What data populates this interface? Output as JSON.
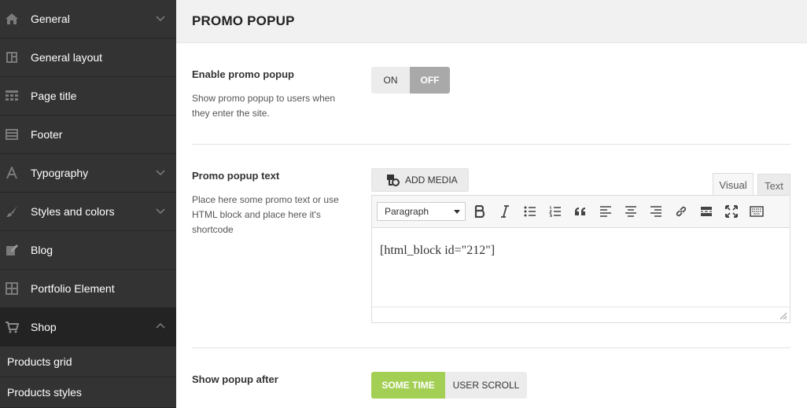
{
  "sidebar": {
    "items": [
      {
        "label": "General",
        "icon": "home-icon",
        "chevron": "down"
      },
      {
        "label": "General layout",
        "icon": "layout-icon",
        "chevron": ""
      },
      {
        "label": "Page title",
        "icon": "grid-icon",
        "chevron": ""
      },
      {
        "label": "Footer",
        "icon": "footer-icon",
        "chevron": ""
      },
      {
        "label": "Typography",
        "icon": "font-icon",
        "chevron": "down"
      },
      {
        "label": "Styles and colors",
        "icon": "brush-icon",
        "chevron": "down"
      },
      {
        "label": "Blog",
        "icon": "edit-icon",
        "chevron": ""
      },
      {
        "label": "Portfolio Element",
        "icon": "portfolio-icon",
        "chevron": ""
      },
      {
        "label": "Shop",
        "icon": "cart-icon",
        "chevron": "up",
        "active": true
      }
    ],
    "sub_items": [
      "Products grid",
      "Products styles"
    ]
  },
  "header": {
    "title": "PROMO POPUP"
  },
  "enable": {
    "title": "Enable promo popup",
    "description": "Show promo popup to users when they enter the site.",
    "on_label": "ON",
    "off_label": "OFF",
    "selected": "OFF"
  },
  "promo_text": {
    "title": "Promo popup text",
    "description": "Place here some promo text or use HTML block and place here it's shortcode",
    "add_media_label": "ADD MEDIA",
    "tab_visual": "Visual",
    "tab_text": "Text",
    "format_value": "Paragraph",
    "content": "[html_block id=\"212\"]"
  },
  "show_after": {
    "title": "Show popup after",
    "option_1": "SOME TIME",
    "option_2": "USER SCROLL",
    "selected": "SOME TIME"
  },
  "colors": {
    "accent": "#a3cf54",
    "sidebar": "#333333",
    "sidebar_active": "#232323"
  }
}
